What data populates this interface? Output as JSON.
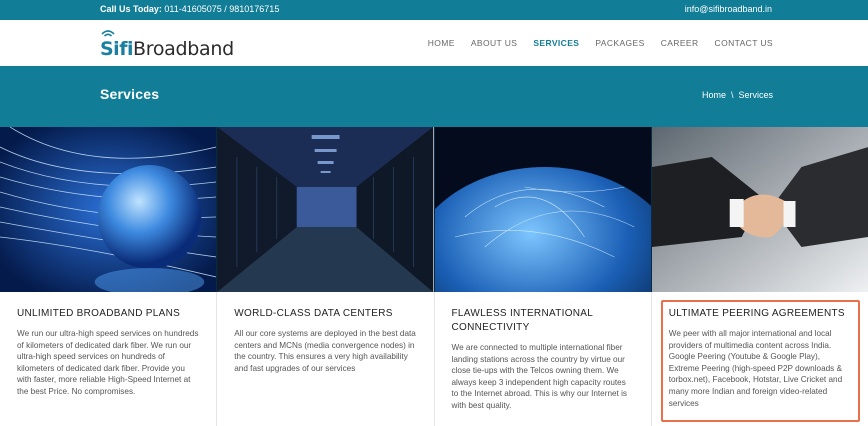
{
  "topbar": {
    "phone_label": "Call Us Today:",
    "phone_numbers": "011-41605075 / 9810176715",
    "email": "info@sifibroadband.in"
  },
  "logo": {
    "part1": "Sifi",
    "part2": "Broadband"
  },
  "nav": {
    "items": [
      {
        "label": "HOME"
      },
      {
        "label": "ABOUT US"
      },
      {
        "label": "SERVICES"
      },
      {
        "label": "PACKAGES"
      },
      {
        "label": "CAREER"
      },
      {
        "label": "CONTACT US"
      }
    ]
  },
  "banner": {
    "title": "Services",
    "breadcrumb_home": "Home",
    "breadcrumb_sep": "\\",
    "breadcrumb_current": "Services"
  },
  "services": [
    {
      "title": "UNLIMITED BROADBAND PLANS",
      "text": "We run our ultra-high speed services on hundreds of kilometers of dedicated dark fiber. We run our ultra-high speed services on hundreds of kilometers of dedicated dark fiber. Provide you with faster, more reliable High-Speed Internet at the best Price. No compromises."
    },
    {
      "title": "WORLD-CLASS DATA CENTERS",
      "text": "All our core systems are deployed in the best data centers and MCNs (media convergence nodes) in the country. This ensures a very high availability and fast upgrades of our services"
    },
    {
      "title": "FLAWLESS INTERNATIONAL CONNECTIVITY",
      "text": "We are connected to multiple international fiber landing stations across the country by virtue our close tie-ups with the Telcos owning them. We always keep 3 independent high capacity routes to the Internet abroad. This is why our Internet is with best quality."
    },
    {
      "title": "ULTIMATE PEERING AGREEMENTS",
      "text": "We peer with all major international and local providers of multimedia content across India. Google Peering (Youtube & Google Play), Extreme Peering (high-speed P2P downloads & torbox.net), Facebook, Hotstar, Live Cricket and many more Indian and foreign video-related services"
    }
  ],
  "colors": {
    "brand": "#117d96",
    "highlight_border": "#e8704a"
  },
  "icons": [
    "wifi-icon"
  ]
}
